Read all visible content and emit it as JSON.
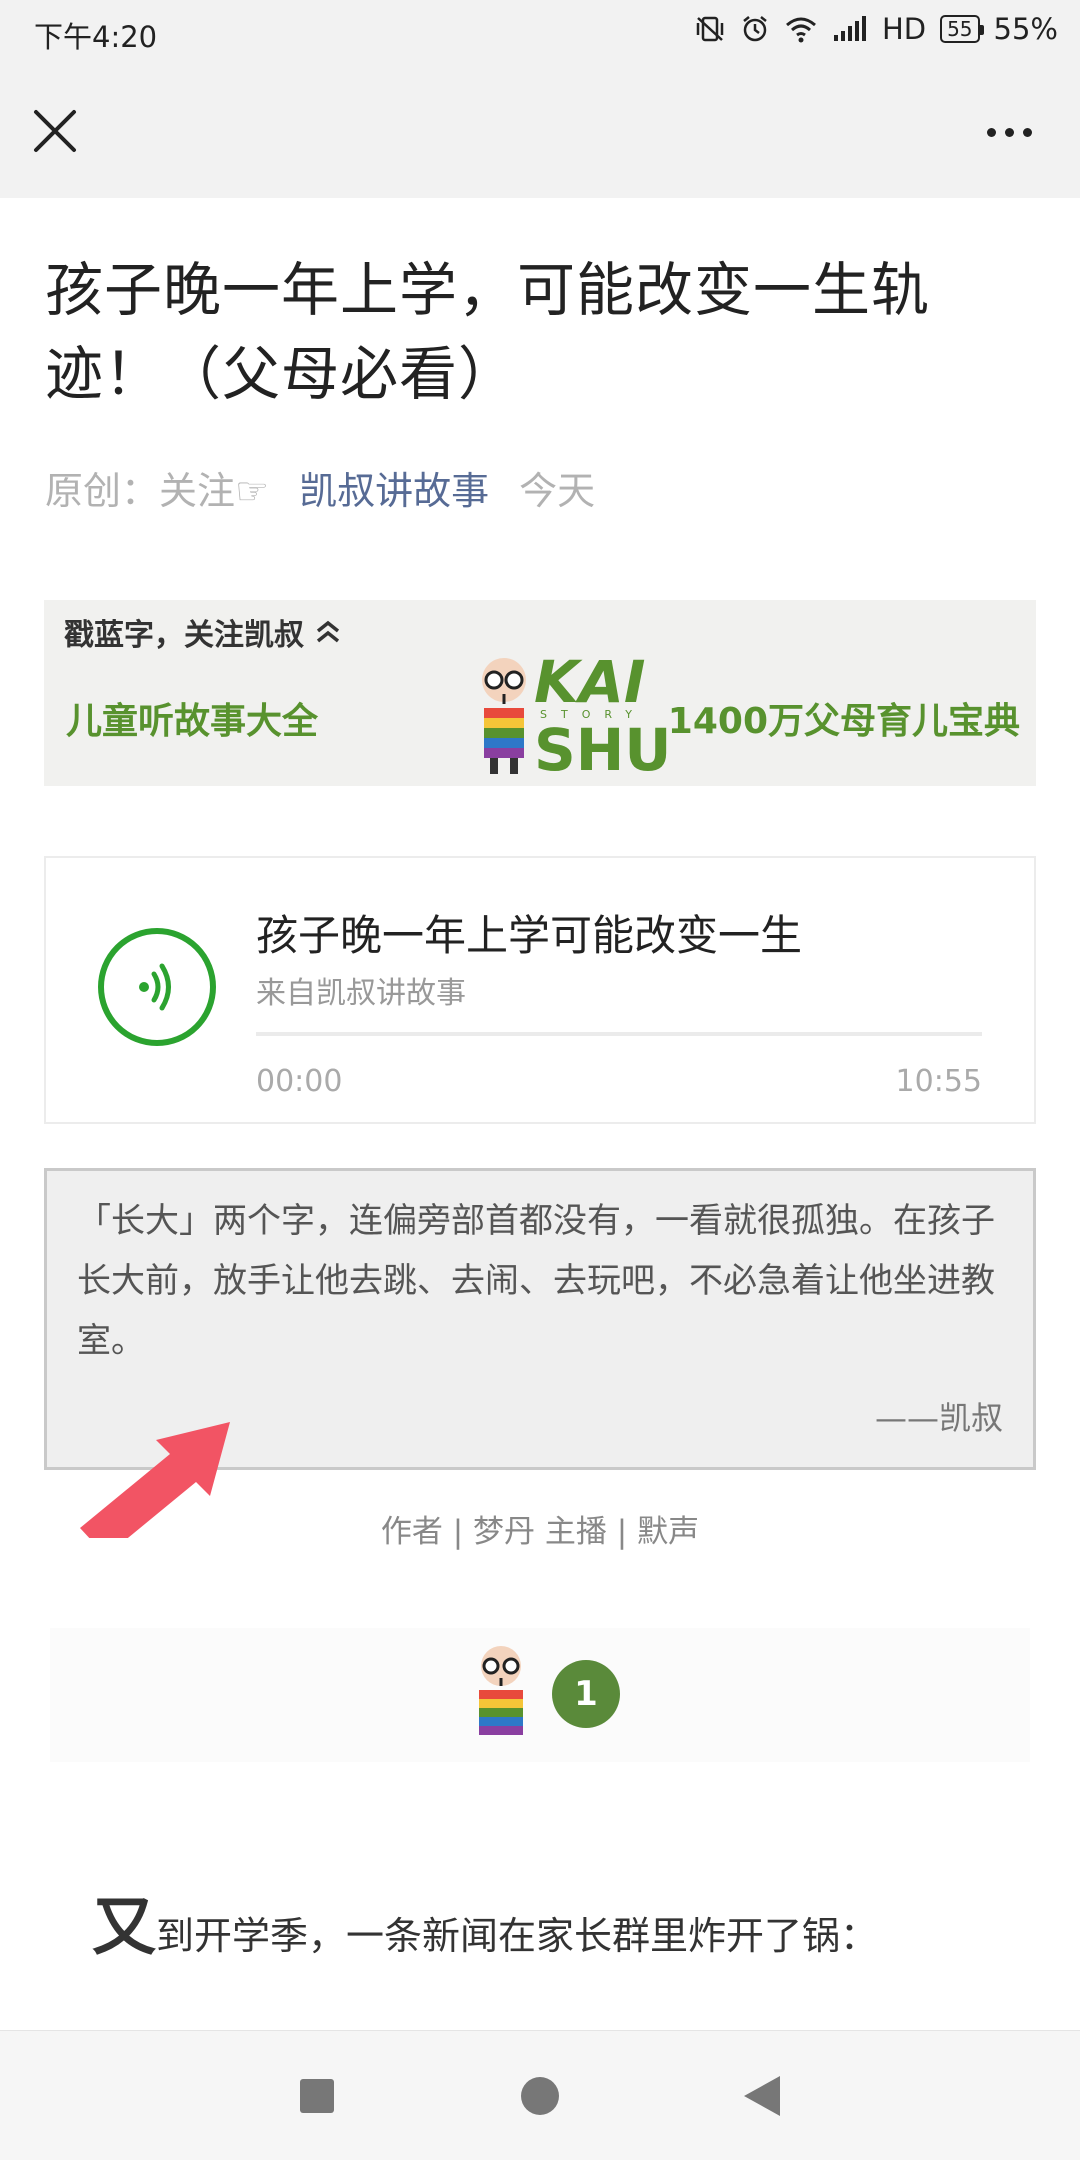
{
  "status": {
    "time": "下午4:20",
    "network": "HD",
    "battery_level": "55",
    "battery_percent": "55%"
  },
  "nav": {
    "close_icon": "close-icon",
    "more_icon": "more-icon"
  },
  "article": {
    "title": "孩子晚一年上学，可能改变一生轨迹！（父母必看）",
    "meta_prefix": "原创：关注☞",
    "account": "凯叔讲故事",
    "date": "今天"
  },
  "banner": {
    "top_text": "戳蓝字，关注凯叔",
    "left_text": "儿童听故事大全",
    "logo_top": "KAI",
    "logo_mid": "STORY",
    "logo_bottom": "SHU",
    "right_text": "1400万父母育儿宝典",
    "accent": "#58922e"
  },
  "audio": {
    "title": "孩子晚一年上学可能改变一生",
    "source": "来自凯叔讲故事",
    "current_time": "00:00",
    "duration": "10:55",
    "progress": 0,
    "accent": "#2ba32f"
  },
  "quote": {
    "text": "「长大」两个字，连偏旁部首都没有，一看就很孤独。在孩子长大前，放手让他去跳、去闹、去玩吧，不必急着让他坐进教室。",
    "signature": "——凯叔"
  },
  "credits": "作者 | 梦丹     主播 | 默声",
  "section": {
    "number": "1",
    "accent": "#5a8a3a"
  },
  "lead": {
    "first_char": "又",
    "rest": "到开学季，一条新闻在家长群里炸开了锅："
  }
}
